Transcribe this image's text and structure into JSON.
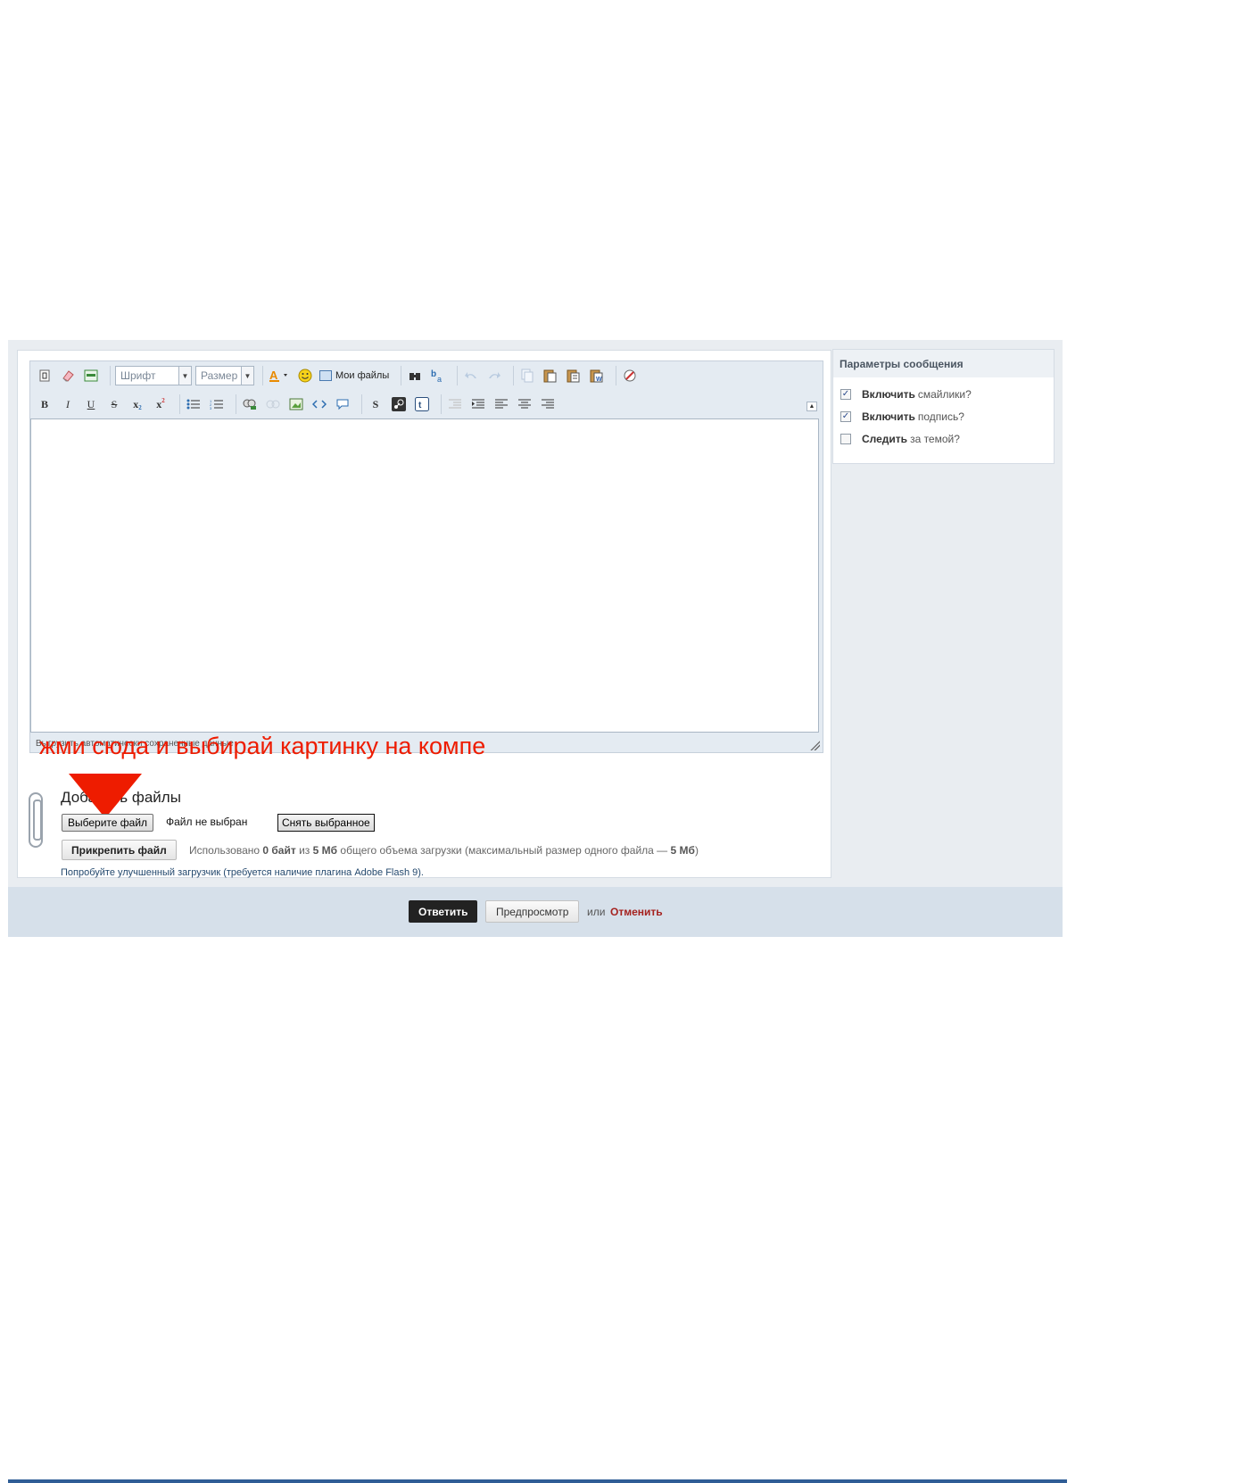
{
  "toolbar": {
    "font_placeholder": "Шрифт",
    "size_placeholder": "Размер",
    "my_files_label": "Мои файлы",
    "row1_icons": [
      "source-icon",
      "eraser-icon",
      "toggle-editor-icon"
    ],
    "row1_after_dd_icons": [
      "text-color-icon",
      "smiley-icon"
    ],
    "row1_tail_icons": [
      "find-icon",
      "replace-icon",
      "undo-icon",
      "redo-icon",
      "copy-icon",
      "paste-icon",
      "paste-text-icon",
      "paste-word-icon",
      "spellcheck-icon"
    ],
    "bold": "B",
    "italic": "I",
    "underline": "U",
    "strike": "S",
    "subscript": "x",
    "superscript": "x",
    "spoiler": "S"
  },
  "editor": {
    "autosave_text": "Выгрузить автоматически сохраненные данные",
    "annotation": "жми сюда и выбирай картинку на компе"
  },
  "attachments": {
    "title": "Добавить файлы",
    "choose_file_button": "Выберите файл",
    "no_file_text": "Файл не выбран",
    "clear_button": "Снять выбранное",
    "attach_button": "Прикрепить файл",
    "usage_prefix": "Использовано",
    "usage_used": "0 байт",
    "usage_of": "из",
    "usage_total": "5 Мб",
    "usage_suffix": "общего объема загрузки (максимальный размер одного файла —",
    "usage_max": "5 Мб",
    "usage_end": ")",
    "flash_link": "Попробуйте улучшенный загрузчик (требуется наличие плагина Adobe Flash 9)."
  },
  "options": {
    "header": "Параметры сообщения",
    "items": [
      {
        "bold": "Включить",
        "rest": "смайлики?",
        "checked": true
      },
      {
        "bold": "Включить",
        "rest": "подпись?",
        "checked": true
      },
      {
        "bold": "Следить",
        "rest": "за темой?",
        "checked": false
      }
    ]
  },
  "footer": {
    "reply_button": "Ответить",
    "preview_button": "Предпросмотр",
    "or_text": "или",
    "cancel_link": "Отменить"
  },
  "colors": {
    "annotation": "#ee1c00",
    "reply_bg": "#222222",
    "cancel": "#a5221f",
    "footer_bg": "#d6e0ea"
  }
}
